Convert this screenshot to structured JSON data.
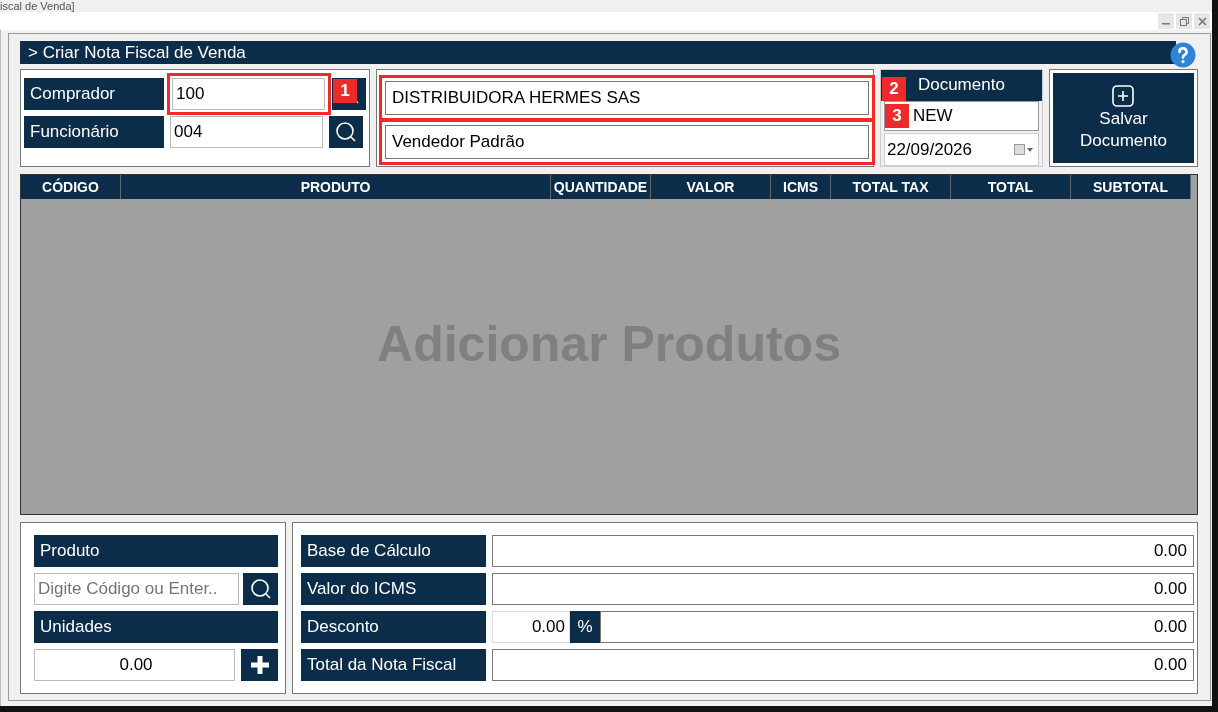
{
  "window": {
    "title": "iscal de Venda]"
  },
  "header": {
    "title": "> Criar Nota Fiscal de Venda"
  },
  "party": {
    "rows": [
      {
        "label": "Comprador",
        "value": "100",
        "name": "DISTRIBUIDORA HERMES SAS"
      },
      {
        "label": "Funcionário",
        "value": "004",
        "name": "Vendedor Padrão"
      }
    ]
  },
  "document": {
    "label": "Documento",
    "number": "NEW",
    "date": "22/09/2026"
  },
  "save_button": {
    "label_lines": [
      "Salvar",
      "Documento"
    ]
  },
  "table": {
    "columns": [
      "CÓDIGO",
      "PRODUTO",
      "QUANTIDADE",
      "VALOR",
      "ICMS",
      "TOTAL TAX",
      "TOTAL",
      "SUBTOTAL"
    ],
    "empty_text": "Adicionar Produtos"
  },
  "product_entry": {
    "product_label": "Produto",
    "placeholder": "Digite Código ou Enter..",
    "units_label": "Unidades",
    "units_value": "0.00"
  },
  "totals": [
    {
      "kind": "plain",
      "label": "Base de Cálculo",
      "value": "0.00"
    },
    {
      "kind": "plain",
      "label": "Valor do ICMS",
      "value": "0.00"
    },
    {
      "kind": "discount",
      "label": "Desconto",
      "percent_value": "0.00",
      "percent_sign": "%",
      "value": "0.00"
    },
    {
      "kind": "plain",
      "label": "Total da Nota Fiscal",
      "value": "0.00"
    }
  ],
  "callouts": [
    {
      "number": "1"
    },
    {
      "number": "2"
    },
    {
      "number": "3"
    }
  ]
}
